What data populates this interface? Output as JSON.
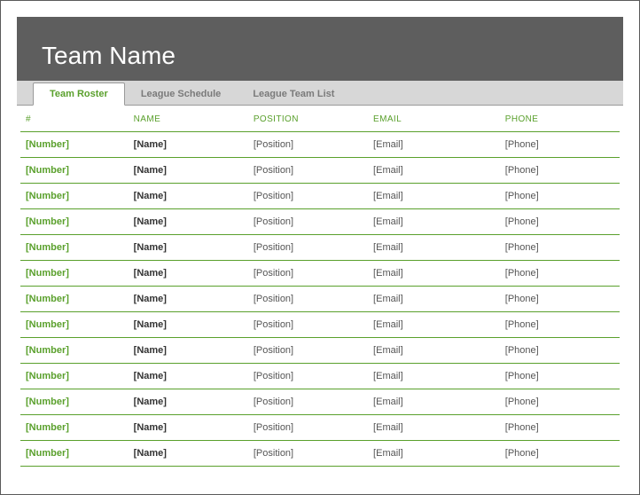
{
  "header": {
    "title": "Team Name"
  },
  "tabs": [
    {
      "label": "Team Roster",
      "active": true
    },
    {
      "label": "League Schedule",
      "active": false
    },
    {
      "label": "League Team List",
      "active": false
    }
  ],
  "columns": {
    "number": "#",
    "name": "NAME",
    "position": "POSITION",
    "email": "EMAIL",
    "phone": "PHONE"
  },
  "rows": [
    {
      "number": "[Number]",
      "name": "[Name]",
      "position": "[Position]",
      "email": "[Email]",
      "phone": "[Phone]"
    },
    {
      "number": "[Number]",
      "name": "[Name]",
      "position": "[Position]",
      "email": "[Email]",
      "phone": "[Phone]"
    },
    {
      "number": "[Number]",
      "name": "[Name]",
      "position": "[Position]",
      "email": "[Email]",
      "phone": "[Phone]"
    },
    {
      "number": "[Number]",
      "name": "[Name]",
      "position": "[Position]",
      "email": "[Email]",
      "phone": "[Phone]"
    },
    {
      "number": "[Number]",
      "name": "[Name]",
      "position": "[Position]",
      "email": "[Email]",
      "phone": "[Phone]"
    },
    {
      "number": "[Number]",
      "name": "[Name]",
      "position": "[Position]",
      "email": "[Email]",
      "phone": "[Phone]"
    },
    {
      "number": "[Number]",
      "name": "[Name]",
      "position": "[Position]",
      "email": "[Email]",
      "phone": "[Phone]"
    },
    {
      "number": "[Number]",
      "name": "[Name]",
      "position": "[Position]",
      "email": "[Email]",
      "phone": "[Phone]"
    },
    {
      "number": "[Number]",
      "name": "[Name]",
      "position": "[Position]",
      "email": "[Email]",
      "phone": "[Phone]"
    },
    {
      "number": "[Number]",
      "name": "[Name]",
      "position": "[Position]",
      "email": "[Email]",
      "phone": "[Phone]"
    },
    {
      "number": "[Number]",
      "name": "[Name]",
      "position": "[Position]",
      "email": "[Email]",
      "phone": "[Phone]"
    },
    {
      "number": "[Number]",
      "name": "[Name]",
      "position": "[Position]",
      "email": "[Email]",
      "phone": "[Phone]"
    },
    {
      "number": "[Number]",
      "name": "[Name]",
      "position": "[Position]",
      "email": "[Email]",
      "phone": "[Phone]"
    }
  ]
}
